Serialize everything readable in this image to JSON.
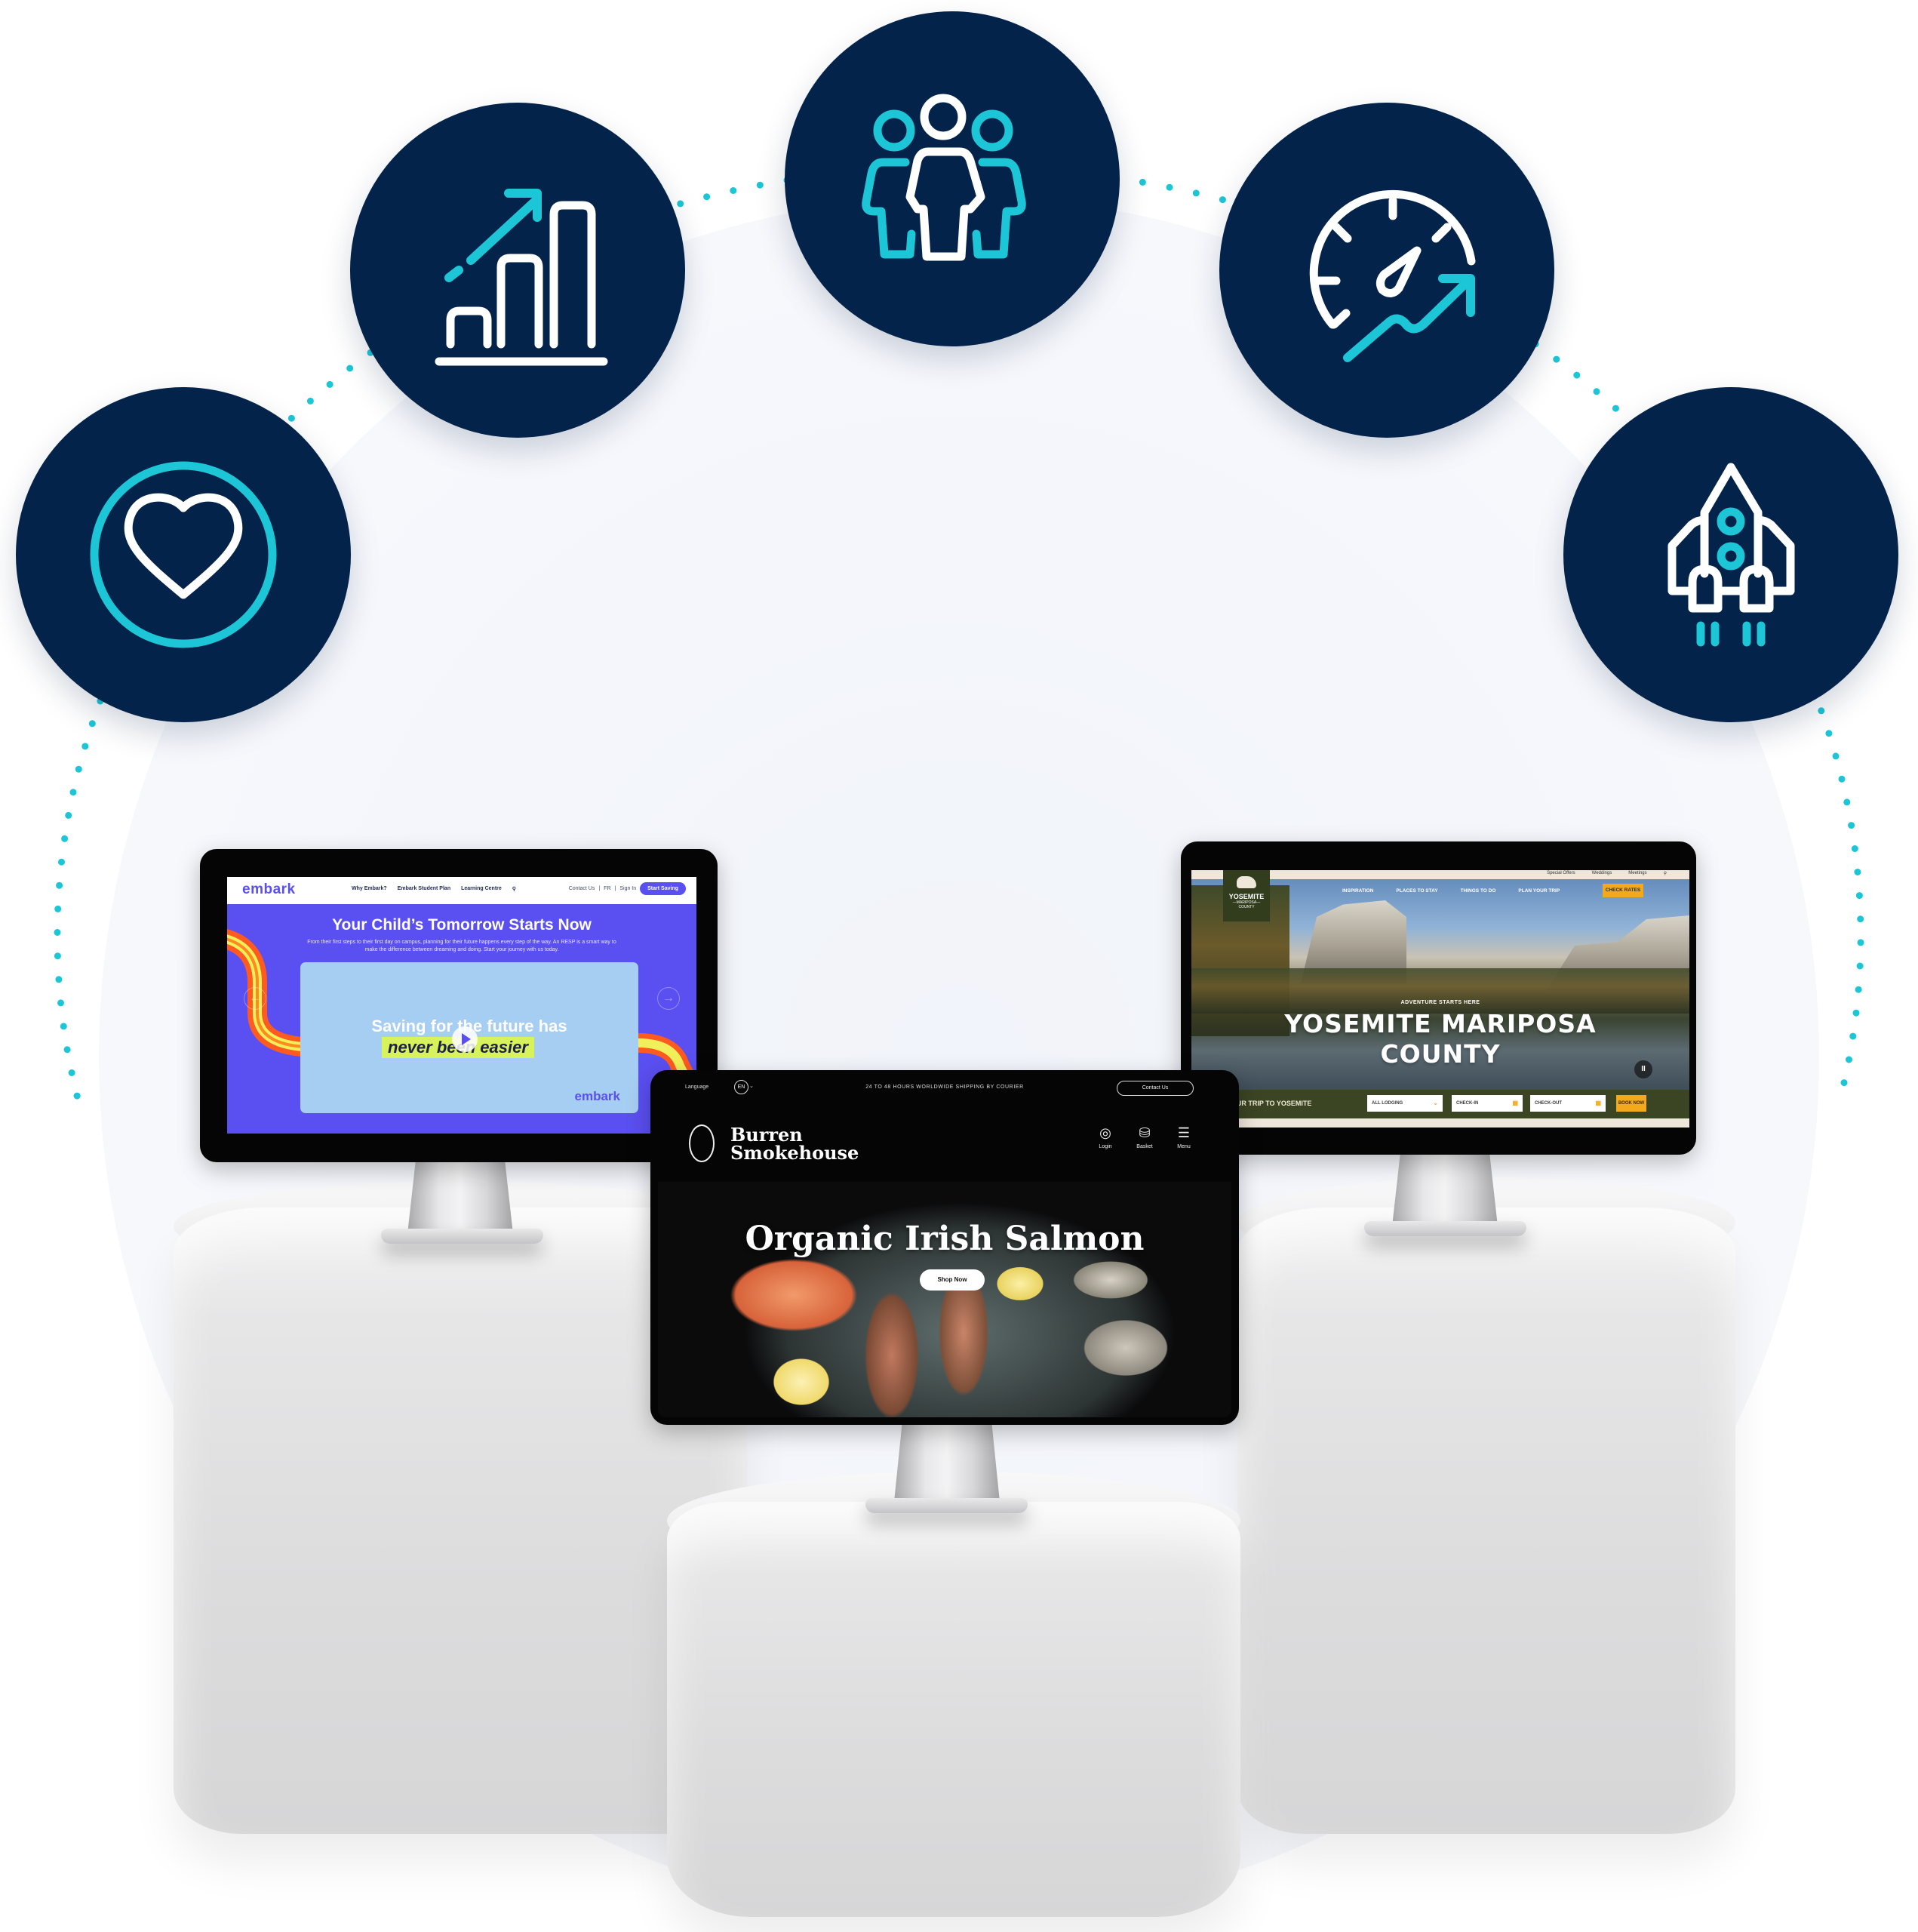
{
  "colors": {
    "icon_circle_bg": "#03234a",
    "accent_teal": "#1cc6d6",
    "icon_white": "#ffffff",
    "embark_purple": "#5a4ff0",
    "embark_card": "#a6cdf2",
    "embark_highlight": "#d8f25c",
    "yosemite_green": "#3b4423",
    "yosemite_orange": "#f4a91c",
    "pedestal_grey": "#dcdcdd"
  },
  "icons": [
    {
      "name": "heart-icon",
      "label": "Heart in circle"
    },
    {
      "name": "growth-chart-icon",
      "label": "Bar chart with rising arrow"
    },
    {
      "name": "team-icon",
      "label": "Three people"
    },
    {
      "name": "speedometer-growth-icon",
      "label": "Speedometer with rising arrow"
    },
    {
      "name": "rocket-icon",
      "label": "Rocket launch"
    }
  ],
  "monitors": {
    "embark": {
      "logo": "embark",
      "nav_links": [
        "Why Embark?",
        "Embark Student Plan",
        "Learning Centre"
      ],
      "search_icon": "search-icon",
      "right_links": [
        "Contact Us",
        "FR",
        "Sign In"
      ],
      "cta": "Start Saving",
      "headline": "Your Child’s Tomorrow Starts Now",
      "subtext": "From their first steps to their first day on campus, planning for their future happens every step of the way. An RESP is a smart way to make the difference between dreaming and doing. Start your journey with us today.",
      "card_line1": "Saving for the future has",
      "card_line2": "never been easier",
      "card_logo": "embark",
      "prev_arrow": "←",
      "next_arrow": "→"
    },
    "burren": {
      "language_label": "Language",
      "language_value": "EN",
      "shipping_banner": "24 TO 48 HOURS WORLDWIDE SHIPPING BY COURIER",
      "contact": "Contact Us",
      "logo_line1": "Burren",
      "logo_line2": "Smokehouse",
      "header_icons": [
        {
          "glyph": "◎",
          "label": "Login"
        },
        {
          "glyph": "⛁",
          "label": "Basket"
        },
        {
          "glyph": "☰",
          "label": "Menu"
        }
      ],
      "headline": "Organic Irish Salmon",
      "cta": "Shop Now"
    },
    "yosemite": {
      "utility_links": [
        "Special Offers",
        "Weddings",
        "Meetings"
      ],
      "logo_line1": "YOSEMITE",
      "logo_line2": "—MARIPOSA—",
      "logo_line3": "COUNTY",
      "nav_links": [
        "INSPIRATION",
        "PLACES TO STAY",
        "THINGS TO DO",
        "PLAN YOUR TRIP"
      ],
      "cta": "CHECK RATES",
      "kicker": "ADVENTURE STARTS HERE",
      "headline_line1": "YOSEMITE MARIPOSA",
      "headline_line2": "COUNTY",
      "pause": "II",
      "bar_label": "PLAN YOUR TRIP TO YOSEMITE",
      "lodging": "ALL LODGING",
      "check_in": "CHECK-IN",
      "check_out": "CHECK-OUT",
      "book": "BOOK NOW"
    }
  }
}
